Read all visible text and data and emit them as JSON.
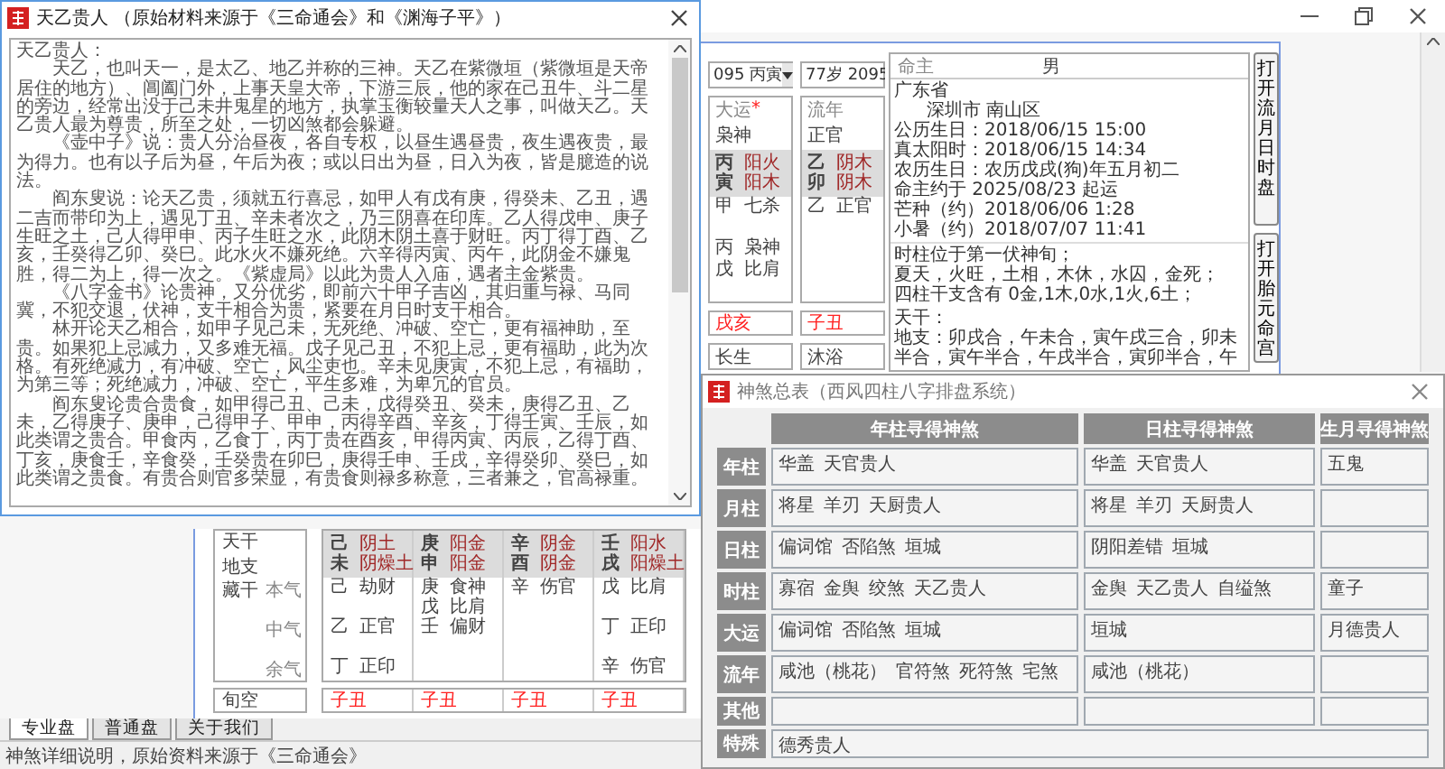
{
  "main_window": {
    "dayun_selector": "095 丙寅",
    "liunian_selector": "77岁 2095",
    "columns": [
      {
        "header": "大运",
        "header_mark": "*",
        "god": "枭神",
        "gan": "丙",
        "gan_element": "阳火",
        "zhi": "寅",
        "zhi_element": "阳木",
        "benqi": [
          {
            "stem": "甲",
            "god": "七杀"
          }
        ],
        "zhongqi": [
          {
            "stem": "丙",
            "god": "枭神"
          }
        ],
        "yuqi": [
          {
            "stem": "戊",
            "god": "比肩"
          }
        ],
        "xunkong": "戌亥",
        "stage": "长生"
      },
      {
        "header": "流年",
        "god": "正官",
        "gan": "乙",
        "gan_element": "阴木",
        "zhi": "卯",
        "zhi_element": "阴木",
        "benqi": [
          {
            "stem": "乙",
            "god": "正官"
          }
        ],
        "xunkong": "子丑",
        "stage": "沐浴"
      }
    ],
    "info": {
      "label": "命主",
      "gender": "男",
      "province": "广东省",
      "district": "深圳市 南山区",
      "lines": [
        "公历生日：2018/06/15 15:00",
        "真太阳时：2018/06/15 14:34",
        "农历生日：农历戊戌(狗)年五月初二",
        "命主约于  2025/08/23 起运",
        "芒种（约）2018/06/06  1:28",
        "小暑（约）2018/07/07  11:41"
      ],
      "analysis": [
        "时柱位于第一伏神旬；",
        "夏天，火旺，土相，木休，水囚，金死；",
        "四柱干支含有 0金,1木,0水,1火,6土；"
      ],
      "relations": [
        "天干：",
        "地支：卯戌合，午未合，寅午戌三合，卯未",
        "半合，寅午半合，午戌半合，寅卯半合，午"
      ]
    },
    "side_buttons": [
      "打开流月日时盘",
      "打开胎元命宫"
    ],
    "pillar_table": {
      "row_labels": {
        "stems": "天干",
        "branches": "地支",
        "hidden": "藏干",
        "benqi": "本气",
        "zhongqi": "中气",
        "yuqi": "余气",
        "xunkong": "旬空"
      },
      "pillars": [
        {
          "gan": "己",
          "gan_element": "阴土",
          "zhi": "未",
          "zhi_element": "阴燥土",
          "benqi": [
            {
              "stem": "己",
              "god": "劫财"
            }
          ],
          "zhongqi": [
            {
              "stem": "乙",
              "god": "正官"
            }
          ],
          "yuqi": [
            {
              "stem": "丁",
              "god": "正印"
            }
          ],
          "xunkong": "子丑"
        },
        {
          "gan": "庚",
          "gan_element": "阳金",
          "zhi": "申",
          "zhi_element": "阳金",
          "benqi": [
            {
              "stem": "庚",
              "god": "食神"
            },
            {
              "stem": "戊",
              "god": "比肩"
            }
          ],
          "zhongqi": [
            {
              "stem": "壬",
              "god": "偏财"
            }
          ],
          "xunkong": "子丑"
        },
        {
          "gan": "辛",
          "gan_element": "阴金",
          "zhi": "酉",
          "zhi_element": "阴金",
          "benqi": [
            {
              "stem": "辛",
              "god": "伤官"
            }
          ],
          "xunkong": "子丑"
        },
        {
          "gan": "壬",
          "gan_element": "阳水",
          "zhi": "戌",
          "zhi_element": "阳燥土",
          "benqi": [
            {
              "stem": "戊",
              "god": "比肩"
            }
          ],
          "zhongqi": [
            {
              "stem": "丁",
              "god": "正印"
            }
          ],
          "yuqi": [
            {
              "stem": "辛",
              "god": "伤官"
            }
          ],
          "xunkong": "子丑"
        }
      ]
    },
    "tabs": [
      {
        "label": "专业盘",
        "selected": true
      },
      {
        "label": "普通盘",
        "selected": false
      },
      {
        "label": "关于我们",
        "selected": false
      }
    ],
    "status_bar": "神煞详细说明，原始资料来源于《三命通会》"
  },
  "detail_dialog": {
    "title": "天乙贵人 （原始材料来源于《三命通会》和《渊海子平》）",
    "heading": "天乙贵人：",
    "paragraphs": [
      "天乙，也叫天一，是太乙、地乙并称的三神。天乙在紫微垣（紫微垣是天帝居住的地方）、阊阖门外，上事天皇大帝，下游三辰，他的家在己丑牛、斗二星的旁边，经常出没于己未井鬼星的地方，执掌玉衡较量天人之事，叫做天乙。天乙贵人最为尊贵，所至之处，一切凶煞都会躲避。",
      "《壶中子》说：贵人分治昼夜，各自专权，以昼生遇昼贵，夜生遇夜贵，最为得力。也有以子后为昼，午后为夜；或以日出为昼，日入为夜，皆是臆造的说法。",
      "阎东叟说：论天乙贵，须就五行喜忌，如甲人有戊有庚，得癸未、乙丑，遇二吉而带印为上，遇见丁丑、辛未者次之，乃三阴喜在印库。乙人得戊申、庚子生旺之土，己人得甲申、丙子生旺之水，此阴木阴土喜于财旺。丙丁得丁酉、乙亥，壬癸得乙卯、癸巳。此水火不嫌死绝。六辛得丙寅、丙午，此阴金不嫌鬼胜，得二为上，得一次之。《紫虚局》以此为贵人入庙，遇者主金紫贵。",
      "《八字金书》论贵神，又分优劣，即前六十甲子吉凶，其归重与禄、马同冀，不犯交退，伏神，支干相合为贵，紧要在月日时支干相合。",
      "林开论天乙相合，如甲子见己未，无死绝、冲破、空亡，更有福神助，至贵。如果犯上忌减力，又多难无福。戊子见己丑，不犯上忌，更有福助，此为次格。有死绝减力，有冲破、空亡，风尘吏也。辛未见庚寅，不犯上忌，有福助，为第三等；死绝减力，冲破、空亡，平生多难，为卑冗的官员。",
      "阎东叟论贵合贵食，如甲得己丑、己未，戊得癸丑、癸未，庚得乙丑、乙未，乙得庚子、庚申，己得甲子、甲申，丙得辛酉、辛亥，丁得壬寅、壬辰，如此类谓之贵合。甲食丙，乙食丁，丙丁贵在酉亥，甲得丙寅、丙辰，乙得丁酉、丁亥，庚食壬，辛食癸，壬癸贵在卯巳，庚得壬申、壬戌，辛得癸卯、癸巳，如此类谓之贵食。有贵合则官多荣显，有贵食则禄多称意，三者兼之，官高禄重。"
    ]
  },
  "shensha_window": {
    "title": "神煞总表（西风四柱八字排盘系统）",
    "columns": [
      "年柱寻得神煞",
      "日柱寻得神煞",
      "生月寻得神煞"
    ],
    "rows": [
      {
        "label": "年柱",
        "by_year": [
          "华盖",
          "天官贵人"
        ],
        "by_day": [
          "华盖",
          "天官贵人"
        ],
        "by_month": [
          "五鬼"
        ]
      },
      {
        "label": "月柱",
        "by_year": [
          "将星",
          "羊刃",
          "天厨贵人"
        ],
        "by_day": [
          "将星",
          "羊刃",
          "天厨贵人"
        ]
      },
      {
        "label": "日柱",
        "by_year": [
          "偏词馆",
          "否陷煞",
          "垣城"
        ],
        "by_day": [
          "阴阳差错",
          "垣城"
        ]
      },
      {
        "label": "时柱",
        "by_year": [
          "寡宿",
          "金舆",
          "绞煞",
          "天乙贵人"
        ],
        "by_day": [
          "金舆",
          "天乙贵人",
          "自缢煞"
        ],
        "by_month": [
          "童子"
        ]
      },
      {
        "label": "大运",
        "by_year": [
          "偏词馆",
          "否陷煞",
          "垣城"
        ],
        "by_day": [
          "垣城"
        ],
        "by_month": [
          "月德贵人"
        ]
      },
      {
        "label": "流年",
        "by_year": [
          "咸池（桃花）",
          "官符煞",
          "死符煞",
          "宅煞"
        ],
        "by_day": [
          "咸池（桃花）"
        ]
      },
      {
        "label": "其他"
      }
    ],
    "special": {
      "label": "特殊",
      "value": "德秀贵人"
    }
  }
}
